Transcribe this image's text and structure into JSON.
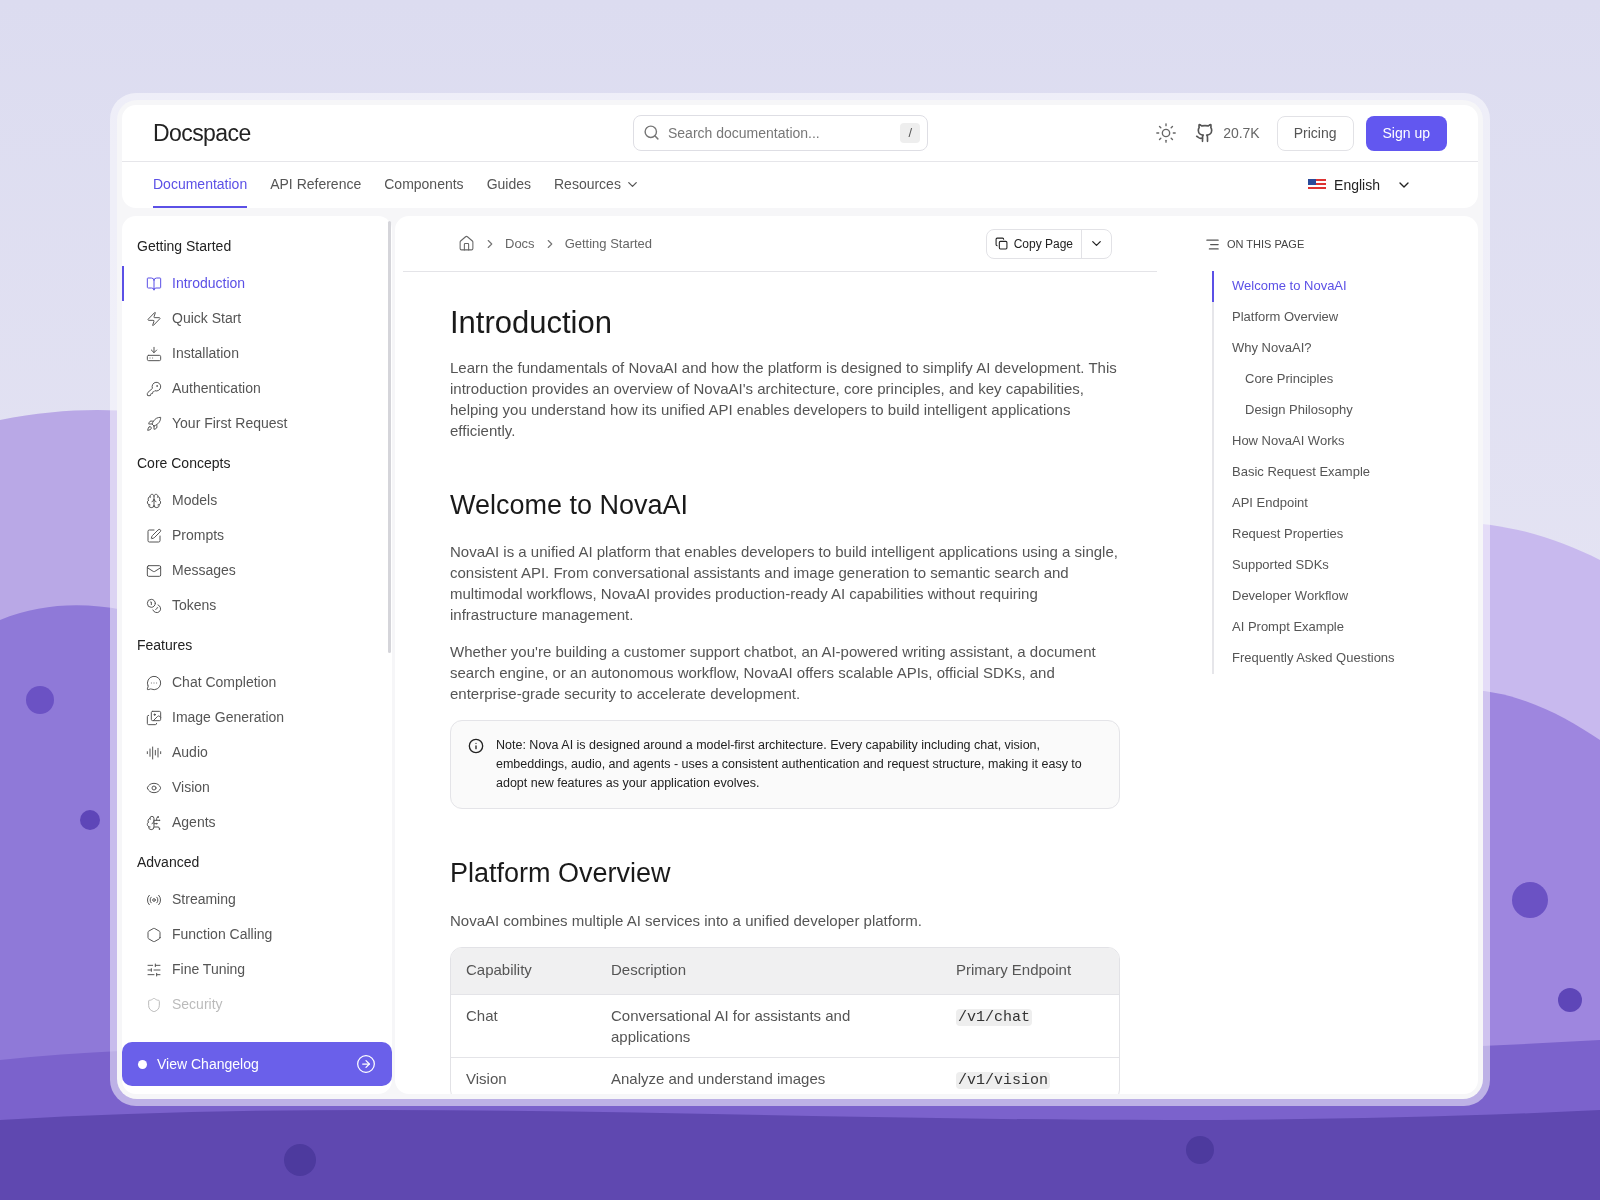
{
  "header": {
    "logo": "Docspace",
    "search": {
      "placeholder": "Search documentation...",
      "shortcut": "/"
    },
    "github_stars": "20.7K",
    "pricing": "Pricing",
    "signup": "Sign up"
  },
  "nav": {
    "tabs": [
      {
        "label": "Documentation",
        "selected": true
      },
      {
        "label": "API Reference",
        "selected": false
      },
      {
        "label": "Components",
        "selected": false
      },
      {
        "label": "Guides",
        "selected": false
      },
      {
        "label": "Resources",
        "selected": false,
        "dropdown": true
      }
    ],
    "language": "English"
  },
  "sidebar": {
    "sections": [
      {
        "title": "Getting Started",
        "items": [
          {
            "label": "Introduction",
            "selected": true
          },
          {
            "label": "Quick Start",
            "selected": false
          },
          {
            "label": "Installation",
            "selected": false
          },
          {
            "label": "Authentication",
            "selected": false
          },
          {
            "label": "Your First Request",
            "selected": false
          }
        ]
      },
      {
        "title": "Core Concepts",
        "items": [
          {
            "label": "Models",
            "selected": false
          },
          {
            "label": "Prompts",
            "selected": false
          },
          {
            "label": "Messages",
            "selected": false
          },
          {
            "label": "Tokens",
            "selected": false
          }
        ]
      },
      {
        "title": "Features",
        "items": [
          {
            "label": "Chat Completion",
            "selected": false
          },
          {
            "label": "Image Generation",
            "selected": false
          },
          {
            "label": "Audio",
            "selected": false
          },
          {
            "label": "Vision",
            "selected": false
          },
          {
            "label": "Agents",
            "selected": false
          }
        ]
      },
      {
        "title": "Advanced",
        "items": [
          {
            "label": "Streaming",
            "selected": false
          },
          {
            "label": "Function Calling",
            "selected": false
          },
          {
            "label": "Fine Tuning",
            "selected": false
          },
          {
            "label": "Security",
            "selected": false
          }
        ]
      }
    ],
    "changelog": "View Changelog"
  },
  "breadcrumb": [
    "Docs",
    "Getting Started"
  ],
  "copy_page": "Copy Page",
  "content": {
    "title": "Introduction",
    "intro": "Learn the fundamentals of NovaAI and how the platform is designed to simplify AI development. This introduction provides an overview of NovaAI's architecture, core principles, and key capabilities, helping you understand how its unified API enables developers to build intelligent applications efficiently.",
    "sections": [
      {
        "heading": "Welcome to NovaAI",
        "paragraphs": [
          "NovaAI is a unified AI platform that enables developers to build intelligent applications using a single, consistent API. From conversational assistants and image generation to semantic search and multimodal workflows, NovaAI provides production-ready AI capabilities without requiring infrastructure management.",
          "Whether you're building a customer support chatbot, an AI-powered writing assistant, a document search engine, or an autonomous workflow, NovaAI offers scalable APIs, official SDKs, and enterprise-grade security to accelerate development."
        ],
        "note": "Note: Nova AI is designed around a model-first architecture. Every capability including chat, vision, embeddings, audio, and agents - uses a consistent authentication and request structure, making it easy to adopt new features as your application evolves."
      },
      {
        "heading": "Platform Overview",
        "paragraphs": [
          "NovaAI combines multiple AI services into a unified developer platform."
        ],
        "table": {
          "columns": [
            "Capability",
            "Description",
            "Primary Endpoint"
          ],
          "rows": [
            [
              "Chat",
              "Conversational AI for assistants and applications",
              "/v1/chat"
            ],
            [
              "Vision",
              "Analyze and understand images",
              "/v1/vision"
            ]
          ]
        }
      }
    ]
  },
  "toc": {
    "title": "ON THIS PAGE",
    "items": [
      {
        "label": "Welcome to NovaAI",
        "selected": true
      },
      {
        "label": "Platform Overview",
        "selected": false
      },
      {
        "label": "Why NovaAI?",
        "selected": false,
        "children": [
          {
            "label": "Core Principles",
            "selected": false
          },
          {
            "label": "Design Philosophy",
            "selected": false
          }
        ]
      },
      {
        "label": "How NovaAI Works",
        "selected": false
      },
      {
        "label": "Basic Request Example",
        "selected": false
      },
      {
        "label": "API Endpoint",
        "selected": false
      },
      {
        "label": "Request Properties",
        "selected": false
      },
      {
        "label": "Supported SDKs",
        "selected": false
      },
      {
        "label": "Developer Workflow",
        "selected": false
      },
      {
        "label": "AI Prompt Example",
        "selected": false
      },
      {
        "label": "Frequently Asked Questions",
        "selected": false
      }
    ]
  }
}
